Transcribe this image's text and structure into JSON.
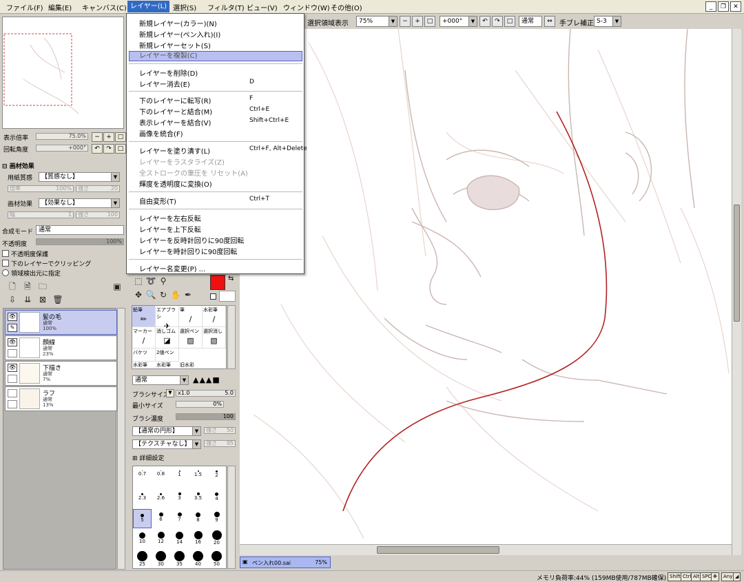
{
  "menubar": {
    "items": [
      "ファイル(F)",
      "編集(E)",
      "キャンバス(C)",
      "レイヤー(L)",
      "選択(S)",
      "フィルタ(T)",
      "ビュー(V)",
      "ウィンドウ(W)",
      "その他(O)"
    ]
  },
  "toolbar": {
    "select_area_label": "選択領域表示",
    "zoom": "75%",
    "rotation": "+000°",
    "blend": "通常",
    "stabilizer_label": "手ブレ補正",
    "stabilizer": "S-3"
  },
  "layer_menu": {
    "items": [
      {
        "label": "新規レイヤー(カラー)(N)",
        "shortcut": "",
        "disabled": false
      },
      {
        "label": "新規レイヤー(ペン入れ)(I)",
        "shortcut": "",
        "disabled": false
      },
      {
        "label": "新規レイヤーセット(S)",
        "shortcut": "",
        "disabled": false
      },
      {
        "label": "レイヤーを複製(C)",
        "shortcut": "",
        "disabled": false,
        "highlighted": true
      },
      {
        "label": "レイヤーを削除(D)",
        "shortcut": "",
        "disabled": false
      },
      {
        "label": "レイヤー消去(E)",
        "shortcut": "D",
        "disabled": false
      },
      {
        "label": "下のレイヤーに転写(R)",
        "shortcut": "F",
        "disabled": false
      },
      {
        "label": "下のレイヤーと結合(M)",
        "shortcut": "Ctrl+E",
        "disabled": false
      },
      {
        "label": "表示レイヤーを結合(V)",
        "shortcut": "Shift+Ctrl+E",
        "disabled": false
      },
      {
        "label": "画像を統合(F)",
        "shortcut": "",
        "disabled": false
      },
      {
        "label": "レイヤーを塗り潰す(L)",
        "shortcut": "Ctrl+F, Alt+Delete",
        "disabled": false
      },
      {
        "label": "レイヤーをラスタライズ(Z)",
        "shortcut": "",
        "disabled": true
      },
      {
        "label": "全ストロークの筆圧を リセット(A)",
        "shortcut": "",
        "disabled": true
      },
      {
        "label": "輝度を透明度に変換(O)",
        "shortcut": "",
        "disabled": false
      },
      {
        "label": "自由変形(T)",
        "shortcut": "Ctrl+T",
        "disabled": false
      },
      {
        "label": "レイヤーを左右反転",
        "shortcut": "",
        "disabled": false
      },
      {
        "label": "レイヤーを上下反転",
        "shortcut": "",
        "disabled": false
      },
      {
        "label": "レイヤーを反時計回りに90度回転",
        "shortcut": "",
        "disabled": false
      },
      {
        "label": "レイヤーを時計回りに90度回転",
        "shortcut": "",
        "disabled": false
      },
      {
        "label": "レイヤー名変更(P) ...",
        "shortcut": "",
        "disabled": false
      }
    ]
  },
  "left_panel": {
    "zoom_label": "表示倍率",
    "zoom_value": "75.0%",
    "rotate_label": "回転角度",
    "rotate_value": "+000°",
    "paper_effect_header": "画材効果",
    "paper_texture_label": "用紙質感",
    "paper_texture_value": "【質感なし】",
    "paper_sub1": "倍率",
    "paper_sub1_value": "100%",
    "paper_sub2": "強さ",
    "paper_sub2_value": "20",
    "effect_label": "画材効果",
    "effect_value": "【効果なし】",
    "effect_sub1": "幅",
    "effect_sub1_value": "1",
    "effect_sub2": "強さ",
    "effect_sub2_value": "100",
    "blend_label": "合成モード",
    "blend_value": "通常",
    "opacity_label": "不透明度",
    "opacity_value": "100%",
    "opacity_fraction": 1.0,
    "chk1": "不透明度保護",
    "chk2": "下のレイヤーでクリッピング",
    "chk3": "領域検出元に指定"
  },
  "layers": [
    {
      "name": "髪の毛",
      "mode": "通常",
      "opacity": "100%",
      "selected": true
    },
    {
      "name": "顔線",
      "mode": "通常",
      "opacity": "23%",
      "selected": false
    },
    {
      "name": "下描き",
      "mode": "通常",
      "opacity": "7%",
      "selected": false
    },
    {
      "name": "ラフ",
      "mode": "通常",
      "opacity": "13%",
      "selected": false
    }
  ],
  "brushes": [
    {
      "label": "鉛筆",
      "icon": "pencil-icon"
    },
    {
      "label": "エアブラシ",
      "icon": "airbrush-icon"
    },
    {
      "label": "筆",
      "icon": "brush-icon"
    },
    {
      "label": "水彩筆",
      "icon": "watercolor-icon"
    },
    {
      "label": "マーカー",
      "icon": "marker-icon"
    },
    {
      "label": "消しゴム",
      "icon": "eraser-icon"
    },
    {
      "label": "選択ペン",
      "icon": "select-pen-icon"
    },
    {
      "label": "選択消し",
      "icon": "select-erase-icon"
    },
    {
      "label": "バケツ",
      "icon": "bucket-icon"
    },
    {
      "label": "2値ペン",
      "icon": "binary-pen-icon"
    },
    {
      "label": "水彩筆",
      "icon": ""
    },
    {
      "label": "水彩筆",
      "icon": ""
    },
    {
      "label": "旧水彩",
      "icon": ""
    }
  ],
  "brush_settings": {
    "mode": "通常",
    "size_label": "ブラシサイズ",
    "size_mult": "x1.0",
    "size_value": "5.0",
    "min_label": "最小サイズ",
    "min_value": "0%",
    "density_label": "ブラシ濃度",
    "density_value": "100",
    "shape": "【通常の円形】",
    "shape_strength": "強さ",
    "shape_strength_value": "50",
    "texture": "【テクスチャなし】",
    "texture_strength": "強さ",
    "texture_strength_value": "95",
    "detail_label": "詳細設定"
  },
  "brush_sizes": [
    "0.7",
    "0.8",
    "1",
    "1.5",
    "2",
    "2.3",
    "2.6",
    "3",
    "3.5",
    "4",
    "5",
    "6",
    "7",
    "8",
    "9",
    "10",
    "12",
    "14",
    "16",
    "20",
    "25",
    "30",
    "35",
    "40",
    "50"
  ],
  "primary_color": "#ee1111",
  "doc_tab": {
    "name": "ペン入れ00.sai",
    "zoom": "75%"
  },
  "status": {
    "memory": "メモリ負荷率:44% (159MB使用/787MB確保)",
    "keys": [
      "Shift",
      "Ctrl",
      "Alt",
      "SPC",
      "Any"
    ]
  }
}
